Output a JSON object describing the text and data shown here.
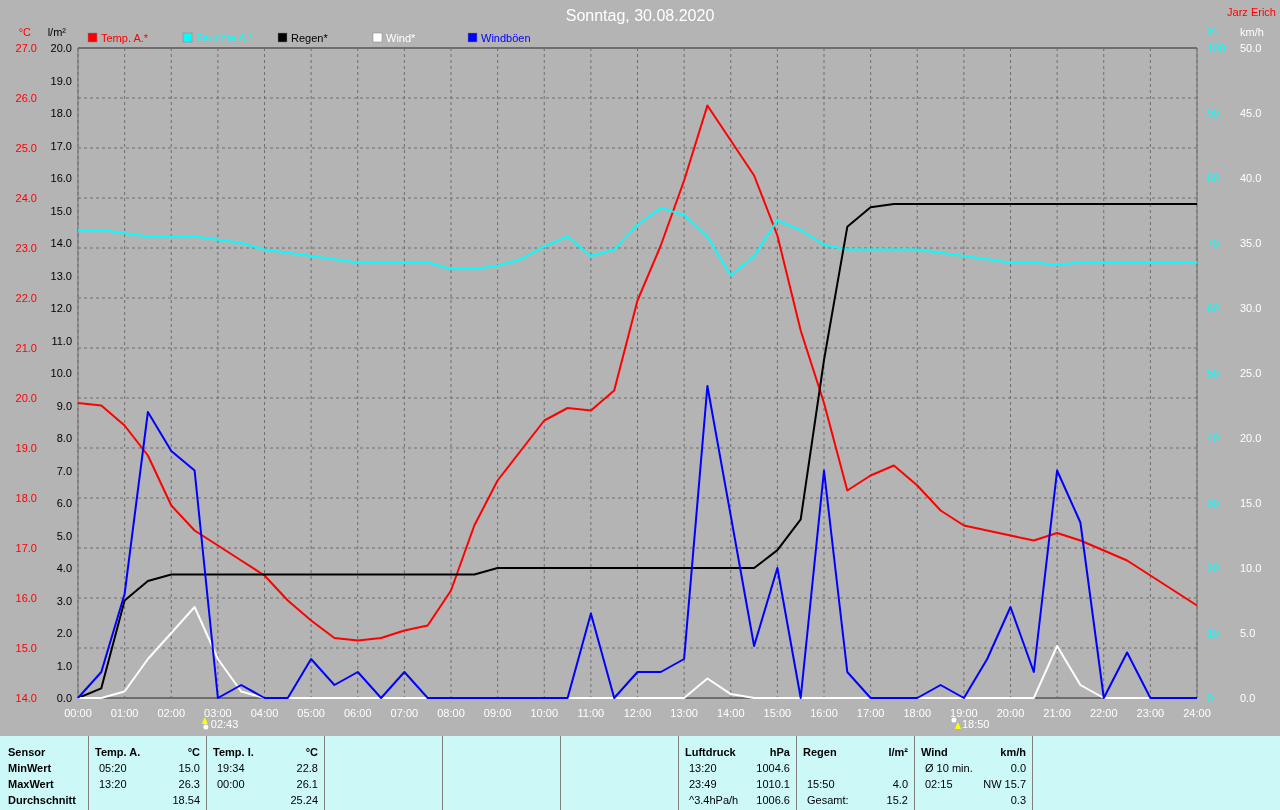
{
  "charts": [
    {
      "chart_data": {
        "type": "line",
        "title": "Sonntag, 30.08.2020",
        "ylabel": "°C",
        "y2label": "%",
        "x": [
          0,
          0.5,
          1,
          1.5,
          2,
          2.5,
          3,
          3.5,
          4,
          4.5,
          5,
          5.5,
          6,
          6.5,
          7,
          7.5,
          8,
          8.5,
          9,
          9.5,
          10,
          10.5,
          11,
          11.5,
          12,
          12.5,
          13,
          13.5,
          14,
          14.5,
          15,
          15.5,
          16,
          16.5,
          17,
          17.5,
          18,
          18.5,
          19,
          19.5,
          20,
          20.5,
          21,
          21.5,
          22,
          22.5,
          23,
          23.5,
          24
        ],
        "xlim": [
          0,
          24
        ],
        "xticks": [
          {
            "value": 0,
            "label": "00:00"
          },
          {
            "value": 1,
            "label": "01:00"
          },
          {
            "value": 2,
            "label": "02:00"
          },
          {
            "value": 3,
            "label": "03:00"
          },
          {
            "value": 4,
            "label": "04:00"
          },
          {
            "value": 5,
            "label": "05:00"
          },
          {
            "value": 6,
            "label": "06:00"
          },
          {
            "value": 7,
            "label": "07:00"
          },
          {
            "value": 8,
            "label": "08:00"
          },
          {
            "value": 9,
            "label": "09:00"
          },
          {
            "value": 10,
            "label": "10:00"
          },
          {
            "value": 11,
            "label": "11:00"
          },
          {
            "value": 12,
            "label": "12:00"
          },
          {
            "value": 13,
            "label": "13:00"
          },
          {
            "value": 14,
            "label": "14:00"
          },
          {
            "value": 15,
            "label": "15:00"
          },
          {
            "value": 16,
            "label": "16:00"
          },
          {
            "value": 17,
            "label": "17:00"
          },
          {
            "value": 18,
            "label": "18:00"
          },
          {
            "value": 19,
            "label": "19:00"
          },
          {
            "value": 20,
            "label": "20:00"
          },
          {
            "value": 21,
            "label": "21:00"
          },
          {
            "value": 22,
            "label": "22:00"
          },
          {
            "value": 23,
            "label": "23:00"
          },
          {
            "value": 24,
            "label": "24:00"
          }
        ],
        "ylim": [
          14,
          27
        ],
        "yticks": [
          {
            "value": 14,
            "label": "14.0"
          },
          {
            "value": 15,
            "label": "15.0"
          },
          {
            "value": 16,
            "label": "16.0"
          },
          {
            "value": 17,
            "label": "17.0"
          },
          {
            "value": 18,
            "label": "18.0"
          },
          {
            "value": 19,
            "label": "19.0"
          },
          {
            "value": 20,
            "label": "20.0"
          },
          {
            "value": 21,
            "label": "21.0"
          },
          {
            "value": 22,
            "label": "22.0"
          },
          {
            "value": 23,
            "label": "23.0"
          },
          {
            "value": 24,
            "label": "24.0"
          },
          {
            "value": 25,
            "label": "25.0"
          },
          {
            "value": 26,
            "label": "26.0"
          },
          {
            "value": 27,
            "label": "27.0"
          }
        ],
        "y2lim": [
          0,
          100
        ],
        "y2ticks": [
          0,
          10,
          20,
          30,
          40,
          50,
          60,
          70,
          80,
          90,
          100
        ],
        "series": [
          {
            "name": "Temp. A.*",
            "color": "#ff0000",
            "values": [
              19.9,
              19.85,
              19.45,
              18.85,
              17.85,
              17.35,
              17.05,
              16.75,
              16.45,
              15.95,
              15.55,
              15.2,
              15.15,
              15.2,
              15.35,
              15.45,
              16.15,
              17.45,
              18.35,
              18.95,
              19.55,
              19.8,
              19.75,
              20.15,
              21.95,
              23.05,
              24.35,
              25.85,
              25.15,
              24.45,
              23.25,
              21.35,
              19.9,
              18.15,
              18.45,
              18.65,
              18.25,
              17.75,
              17.45,
              17.35,
              17.25,
              17.15,
              17.3,
              17.15,
              16.95,
              16.75,
              16.45,
              16.15,
              15.85
            ]
          },
          {
            "name": "Feuchte A.*",
            "color": "#00ffff",
            "axis": "y2",
            "values": [
              72,
              72,
              71.5,
              71,
              71,
              71,
              70.5,
              70,
              69,
              68.5,
              68,
              67.5,
              67,
              67,
              67,
              67,
              66,
              66,
              66.5,
              67.5,
              69.5,
              71,
              68,
              69,
              72.8,
              75.4,
              74.3,
              71,
              65,
              68,
              73.5,
              72,
              69.7,
              69,
              69,
              69,
              69,
              68.5,
              68,
              67.5,
              67,
              67,
              66.6,
              67,
              67,
              67,
              67,
              67,
              67
            ]
          }
        ],
        "grid": true,
        "legend": "top"
      }
    },
    {
      "chart_data": {
        "type": "line",
        "ylabel": "l/m²",
        "y2label": "km/h",
        "legend": "top",
        "x": [
          0,
          0.5,
          1,
          1.5,
          2,
          2.5,
          3,
          3.5,
          4,
          4.5,
          5,
          5.5,
          6,
          6.5,
          7,
          7.5,
          8,
          8.5,
          9,
          9.5,
          10,
          10.5,
          11,
          11.5,
          12,
          12.5,
          13,
          13.5,
          14,
          14.5,
          15,
          15.5,
          16,
          16.5,
          17,
          17.5,
          18,
          18.5,
          19,
          19.5,
          20,
          20.5,
          21,
          21.5,
          22,
          22.5,
          23,
          23.5,
          24
        ],
        "xlim": [
          0,
          24
        ],
        "ylim": [
          0,
          20
        ],
        "yticks": [
          {
            "value": 0,
            "label": "0.0"
          },
          {
            "value": 1,
            "label": "1.0"
          },
          {
            "value": 2,
            "label": "2.0"
          },
          {
            "value": 3,
            "label": "3.0"
          },
          {
            "value": 4,
            "label": "4.0"
          },
          {
            "value": 5,
            "label": "5.0"
          },
          {
            "value": 6,
            "label": "6.0"
          },
          {
            "value": 7,
            "label": "7.0"
          },
          {
            "value": 8,
            "label": "8.0"
          },
          {
            "value": 9,
            "label": "9.0"
          },
          {
            "value": 10,
            "label": "10.0"
          },
          {
            "value": 11,
            "label": "11.0"
          },
          {
            "value": 12,
            "label": "12.0"
          },
          {
            "value": 13,
            "label": "13.0"
          },
          {
            "value": 14,
            "label": "14.0"
          },
          {
            "value": 15,
            "label": "15.0"
          },
          {
            "value": 16,
            "label": "16.0"
          },
          {
            "value": 17,
            "label": "17.0"
          },
          {
            "value": 18,
            "label": "18.0"
          },
          {
            "value": 19,
            "label": "19.0"
          },
          {
            "value": 20,
            "label": "20.0"
          }
        ],
        "y2lim": [
          0,
          50
        ],
        "y2ticks": [
          {
            "value": 0,
            "label": "0.0"
          },
          {
            "value": 5,
            "label": "5.0"
          },
          {
            "value": 10,
            "label": "10.0"
          },
          {
            "value": 15,
            "label": "15.0"
          },
          {
            "value": 20,
            "label": "20.0"
          },
          {
            "value": 25,
            "label": "25.0"
          },
          {
            "value": 30,
            "label": "30.0"
          },
          {
            "value": 35,
            "label": "35.0"
          },
          {
            "value": 40,
            "label": "40.0"
          },
          {
            "value": 45,
            "label": "45.0"
          },
          {
            "value": 50,
            "label": "50.0"
          }
        ],
        "series": [
          {
            "name": "Regen*",
            "color": "#000000",
            "values": [
              0,
              0.3,
              3.0,
              3.6,
              3.8,
              3.8,
              3.8,
              3.8,
              3.8,
              3.8,
              3.8,
              3.8,
              3.8,
              3.8,
              3.8,
              3.8,
              3.8,
              3.8,
              4.0,
              4.0,
              4.0,
              4.0,
              4.0,
              4.0,
              4.0,
              4.0,
              4.0,
              4.0,
              4.0,
              4.0,
              4.55,
              5.5,
              10.4,
              14.5,
              15.1,
              15.2,
              15.2,
              15.2,
              15.2,
              15.2,
              15.2,
              15.2,
              15.2,
              15.2,
              15.2,
              15.2,
              15.2,
              15.2,
              15.2
            ]
          },
          {
            "name": "Wind*",
            "color": "#ffffff",
            "axis": "y2",
            "values": [
              0,
              0,
              0.5,
              3,
              5,
              7,
              3,
              0.5,
              0,
              0,
              0,
              0,
              0,
              0,
              0,
              0,
              0,
              0,
              0,
              0,
              0,
              0,
              0,
              0,
              0,
              0,
              0,
              1.5,
              0.3,
              0,
              0,
              0,
              0,
              0,
              0,
              0,
              0,
              0,
              0,
              0,
              0,
              0,
              4,
              1,
              0,
              0,
              0,
              0,
              0
            ]
          },
          {
            "name": "Windböen",
            "color": "#0000ff",
            "axis": "y2",
            "values": [
              0,
              2,
              8,
              22,
              19,
              17.5,
              0,
              1,
              0,
              0,
              3,
              1,
              2,
              0,
              2,
              0,
              0,
              0,
              0,
              0,
              0,
              0,
              6.5,
              0,
              2,
              2,
              3,
              24,
              14,
              4,
              10,
              0,
              17.5,
              2,
              0,
              0,
              0,
              1,
              0,
              3,
              7,
              2,
              17.5,
              13.5,
              0,
              3.5,
              0,
              0,
              0
            ]
          }
        ]
      }
    }
  ],
  "sun_markers": [
    {
      "kind": "sunrise",
      "text": "02:43"
    },
    {
      "kind": "sunset",
      "text": "18:50"
    }
  ],
  "author": "Jarz Erich",
  "stats": {
    "row_labels": [
      "Sensor",
      "MinWert",
      "MaxWert",
      "Durchschnitt"
    ],
    "sections": [
      {
        "kind": "data",
        "title": "Temp. A.",
        "unit": "°C",
        "rows": [
          {
            "time": "05:20",
            "value": "15.0"
          },
          {
            "time": "13:20",
            "value": "26.3"
          },
          {
            "value": "18.54"
          }
        ]
      },
      {
        "kind": "data",
        "title": "Temp. I.",
        "unit": "°C",
        "rows": [
          {
            "time": "19:34",
            "value": "22.8"
          },
          {
            "time": "00:00",
            "value": "26.1"
          },
          {
            "value": "25.24"
          }
        ]
      },
      {
        "kind": "empty"
      },
      {
        "kind": "empty"
      },
      {
        "kind": "empty"
      },
      {
        "kind": "data",
        "title": "Luftdruck",
        "unit": "hPa",
        "rows": [
          {
            "time": "13:20",
            "value": "1004.6"
          },
          {
            "time": "23:49",
            "value": "1010.1"
          },
          {
            "time": "^3.4hPa/h",
            "value": "1006.6"
          }
        ]
      },
      {
        "kind": "data",
        "title": "Regen",
        "unit": "l/m²",
        "rows": [
          {},
          {
            "time": "15:50",
            "value": "4.0"
          },
          {
            "time": "Gesamt:",
            "value": "15.2"
          }
        ]
      },
      {
        "kind": "data",
        "title": "Wind",
        "unit": "km/h",
        "rows": [
          {
            "time": "Ø 10 min.",
            "value": "0.0"
          },
          {
            "time": "02:15",
            "value": "NW 15.7"
          },
          {
            "value": "0.3"
          }
        ]
      }
    ]
  }
}
